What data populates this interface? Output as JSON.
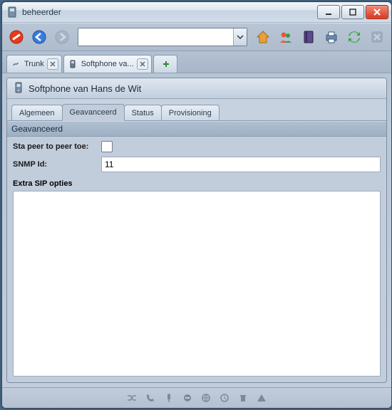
{
  "window": {
    "title": "beheerder"
  },
  "toolbar": {
    "address_value": "",
    "address_placeholder": ""
  },
  "tabs": [
    {
      "label": "Trunk",
      "active": false
    },
    {
      "label": "Softphone va...",
      "active": true
    }
  ],
  "panel": {
    "title": "Softphone van Hans de Wit"
  },
  "inner_tabs": [
    {
      "label": "Algemeen",
      "active": false
    },
    {
      "label": "Geavanceerd",
      "active": true
    },
    {
      "label": "Status",
      "active": false
    },
    {
      "label": "Provisioning",
      "active": false
    }
  ],
  "section": {
    "title": "Geavanceerd"
  },
  "form": {
    "p2p_label": "Sta peer to peer toe:",
    "p2p_checked": false,
    "snmp_label": "SNMP Id:",
    "snmp_value": "11",
    "sip_label": "Extra SIP opties",
    "sip_value": ""
  }
}
